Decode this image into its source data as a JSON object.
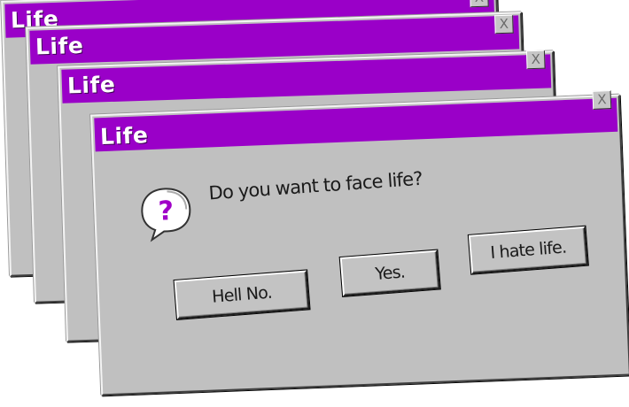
{
  "windows": [
    {
      "title": "Life",
      "close_glyph": "X"
    },
    {
      "title": "Life",
      "close_glyph": "X"
    },
    {
      "title": "Life",
      "close_glyph": "X"
    },
    {
      "title": "Life",
      "close_glyph": "X",
      "icon": "help-question-balloon-icon",
      "message": "Do you want to face life?",
      "buttons": {
        "hell_no": "Hell No.",
        "yes": "Yes.",
        "hate": "I hate life."
      }
    }
  ],
  "colors": {
    "titlebar": "#9a00c8",
    "dialog_face": "#c0c0c0",
    "question_mark": "#a000c8"
  }
}
